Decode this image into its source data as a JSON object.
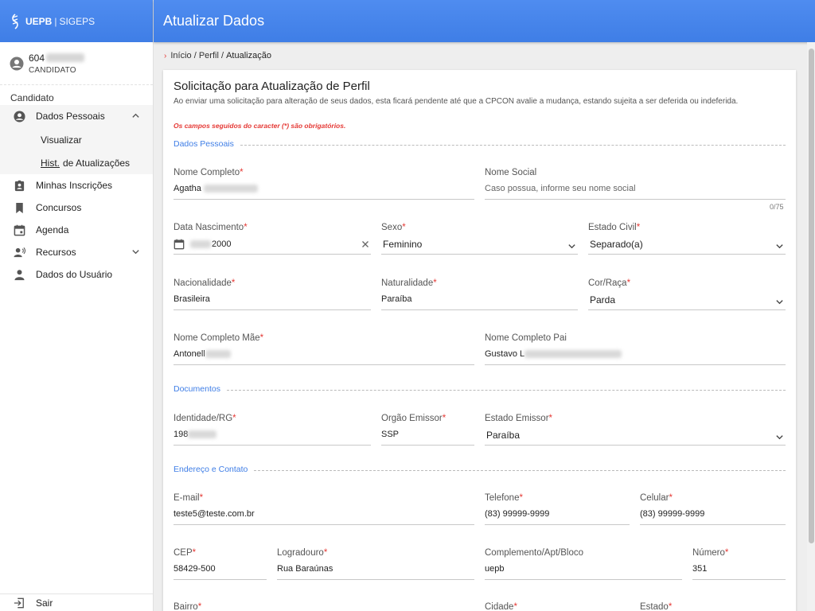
{
  "brand": {
    "name_bold": "UEPB",
    "separator": "|",
    "name_rest": "SIGEPS"
  },
  "header": {
    "title": "Atualizar Dados"
  },
  "user": {
    "id_prefix": "604",
    "role": "CANDIDATO"
  },
  "sidebar": {
    "section_title": "Candidato",
    "dados_pessoais": "Dados Pessoais",
    "sub_visualizar": "Visualizar",
    "sub_hist_abbr": "Hist.",
    "sub_hist_rest": "de Atualizações",
    "minhas_inscricoes": "Minhas Inscrições",
    "concursos": "Concursos",
    "agenda": "Agenda",
    "recursos": "Recursos",
    "dados_usuario": "Dados do Usuário",
    "logout": "Sair"
  },
  "breadcrumb": {
    "inicio": "Início",
    "sep1": "/",
    "perfil": "Perfil",
    "sep2": "/",
    "atual": "Atualização"
  },
  "form": {
    "title": "Solicitação para Atualização de Perfil",
    "description": "Ao enviar uma solicitação para alteração de seus dados, esta ficará pendente até que a CPCON avalie a mudança, estando sujeita a ser deferida ou indeferida.",
    "required_note": "Os campos seguidos do caracter (*) são obrigatórios.",
    "required_mark": "*",
    "sections": {
      "pessoais": "Dados Pessoais",
      "documentos": "Documentos",
      "endereco": "Endereço e Contato"
    },
    "nome_completo": {
      "label": "Nome Completo",
      "value": "Agatha"
    },
    "nome_social": {
      "label": "Nome Social",
      "placeholder": "Caso possua, informe seu nome social",
      "counter": "0/75"
    },
    "data_nascimento": {
      "label": "Data Nascimento",
      "value": "2000"
    },
    "sexo": {
      "label": "Sexo",
      "value": "Feminino"
    },
    "estado_civil": {
      "label": "Estado Civil",
      "value": "Separado(a)"
    },
    "nacionalidade": {
      "label": "Nacionalidade",
      "value": "Brasileira"
    },
    "naturalidade": {
      "label": "Naturalidade",
      "value": "Paraíba"
    },
    "cor_raca": {
      "label": "Cor/Raça",
      "value": "Parda"
    },
    "nome_mae": {
      "label": "Nome Completo Mãe",
      "value": "Antonell"
    },
    "nome_pai": {
      "label": "Nome Completo Pai",
      "value": "Gustavo L"
    },
    "identidade": {
      "label": "Identidade/RG",
      "value": "198"
    },
    "orgao_emissor": {
      "label": "Orgão Emissor",
      "value": "SSP"
    },
    "estado_emissor": {
      "label": "Estado Emissor",
      "value": "Paraíba"
    },
    "email": {
      "label": "E-mail",
      "value": "teste5@teste.com.br"
    },
    "telefone": {
      "label": "Telefone",
      "value": "(83) 99999-9999"
    },
    "celular": {
      "label": "Celular",
      "value": "(83) 99999-9999"
    },
    "cep": {
      "label": "CEP",
      "value": "58429-500"
    },
    "logradouro": {
      "label": "Logradouro",
      "value": "Rua Baraúnas"
    },
    "complemento": {
      "label": "Complemento/Apt/Bloco",
      "value": "uepb"
    },
    "numero": {
      "label": "Número",
      "value": "351"
    },
    "bairro": {
      "label": "Bairro"
    },
    "cidade": {
      "label": "Cidade"
    },
    "estado": {
      "label": "Estado"
    }
  },
  "colors": {
    "primary": "#3f7ee6",
    "required": "#e53935"
  }
}
